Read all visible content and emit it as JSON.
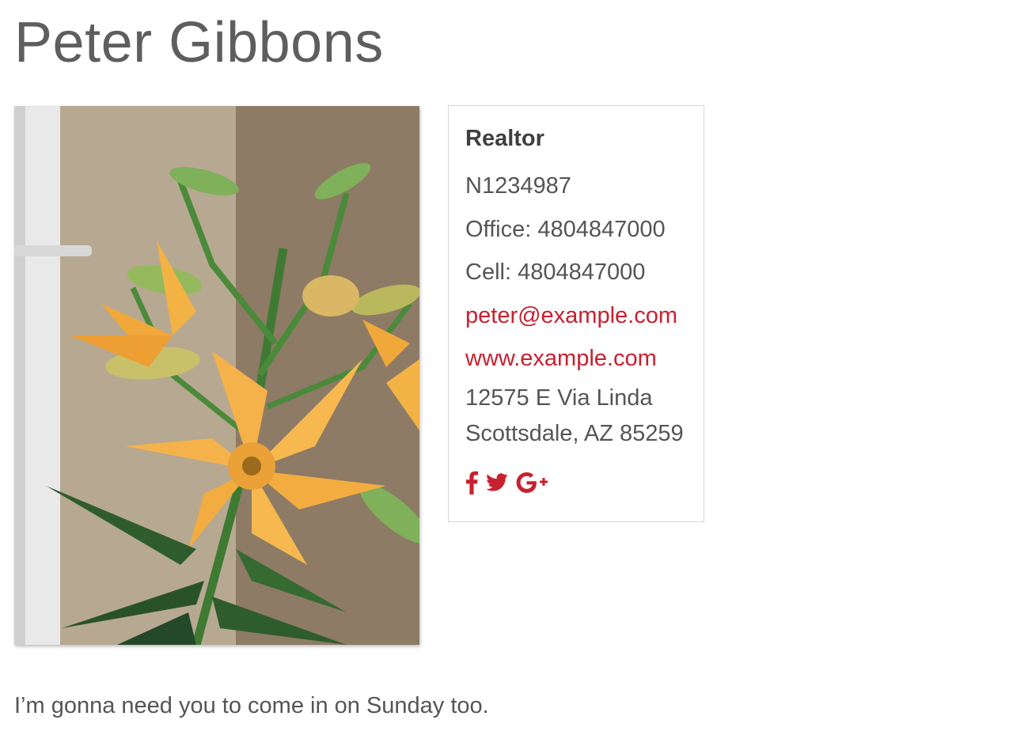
{
  "agent": {
    "name": "Peter Gibbons",
    "role": "Realtor",
    "license": "N1234987",
    "office_label": "Office: 4804847000",
    "cell_label": "Cell: 4804847000",
    "email": "peter@example.com",
    "website": "www.example.com",
    "address_line1": "12575 E Via Linda",
    "address_line2": "Scottsdale, AZ 85259",
    "bio": "I’m gonna need you to come in on Sunday too."
  },
  "social": {
    "icons": [
      "facebook-icon",
      "twitter-icon",
      "google-plus-icon"
    ],
    "color": "#c8202f"
  },
  "colors": {
    "accent": "#c8202f",
    "text": "#555555",
    "title": "#5e5e5e"
  }
}
